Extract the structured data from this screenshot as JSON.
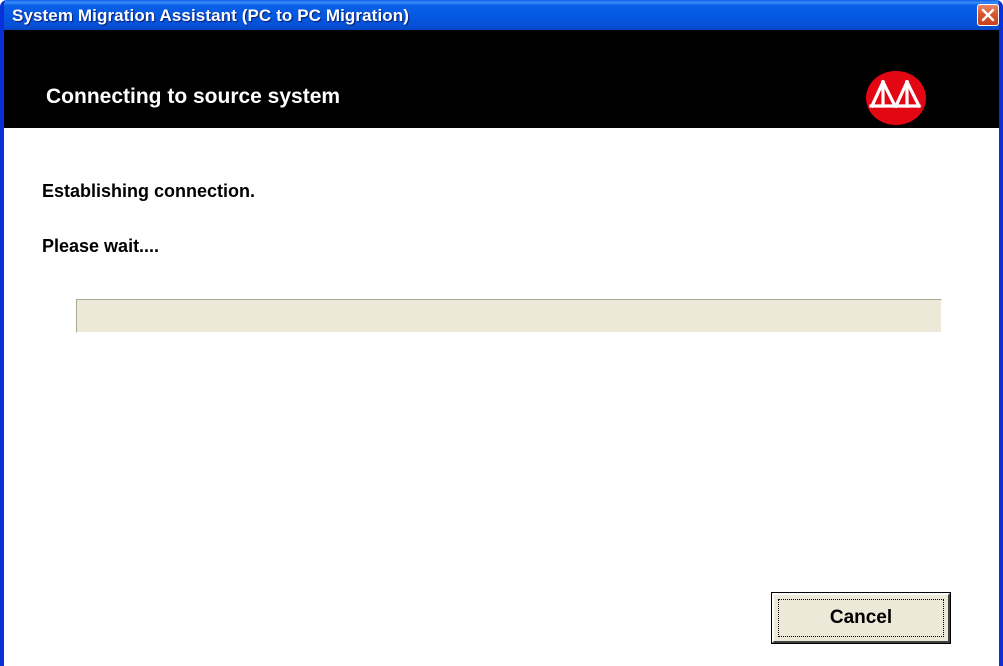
{
  "window": {
    "title": "System Migration Assistant (PC to PC Migration)",
    "close_icon": "close-icon",
    "colors": {
      "titlebar": "#0558e0",
      "frame": "#0831d9",
      "close_button": "#d9562e"
    }
  },
  "header": {
    "title": "Connecting to source system",
    "background": "#000000",
    "logo_icon": "bridge-logo-icon",
    "logo_color": "#e30613"
  },
  "content": {
    "status_line_1": "Establishing connection.",
    "status_line_2": "Please wait....",
    "progress_percent": 0
  },
  "footer": {
    "cancel_label": "Cancel"
  }
}
